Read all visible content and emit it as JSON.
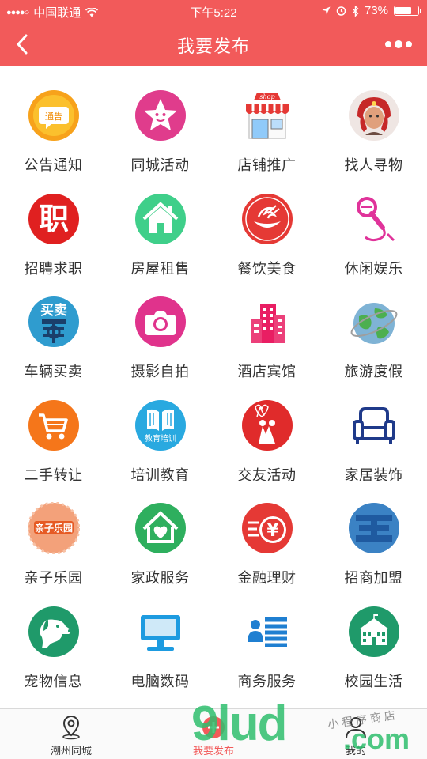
{
  "status_bar": {
    "carrier": "中国联通",
    "time": "下午5:22",
    "battery_text": "73%",
    "battery_level": 0.73
  },
  "nav": {
    "title": "我要发布"
  },
  "grid": {
    "items": [
      {
        "label": "公告通知",
        "icon": "announcement-icon",
        "badge": "通告"
      },
      {
        "label": "同城活动",
        "icon": "star-activity-icon"
      },
      {
        "label": "店铺推广",
        "icon": "shop-icon",
        "badge": "shop"
      },
      {
        "label": "找人寻物",
        "icon": "person-search-icon"
      },
      {
        "label": "招聘求职",
        "icon": "recruit-icon",
        "badge": "职"
      },
      {
        "label": "房屋租售",
        "icon": "house-icon"
      },
      {
        "label": "餐饮美食",
        "icon": "dining-icon"
      },
      {
        "label": "休闲娱乐",
        "icon": "microphone-icon"
      },
      {
        "label": "车辆买卖",
        "icon": "vehicle-trade-icon",
        "badge": "买卖"
      },
      {
        "label": "摄影自拍",
        "icon": "camera-icon"
      },
      {
        "label": "酒店宾馆",
        "icon": "hotel-icon"
      },
      {
        "label": "旅游度假",
        "icon": "globe-icon"
      },
      {
        "label": "二手转让",
        "icon": "cart-icon"
      },
      {
        "label": "培训教育",
        "icon": "education-icon",
        "badge": "教育培训"
      },
      {
        "label": "交友活动",
        "icon": "dating-icon"
      },
      {
        "label": "家居装饰",
        "icon": "sofa-icon"
      },
      {
        "label": "亲子乐园",
        "icon": "family-icon",
        "badge": "亲子乐园"
      },
      {
        "label": "家政服务",
        "icon": "housekeeping-icon"
      },
      {
        "label": "金融理财",
        "icon": "finance-icon",
        "badge": "¥"
      },
      {
        "label": "招商加盟",
        "icon": "franchise-icon"
      },
      {
        "label": "宠物信息",
        "icon": "pet-icon"
      },
      {
        "label": "电脑数码",
        "icon": "computer-icon"
      },
      {
        "label": "商务服务",
        "icon": "business-icon"
      },
      {
        "label": "校园生活",
        "icon": "school-icon"
      }
    ]
  },
  "tabbar": {
    "tabs": [
      {
        "label": "潮州同城",
        "icon": "location-pin-icon"
      },
      {
        "label": "我要发布",
        "icon": "publish-icon",
        "active": true
      },
      {
        "label": "我的",
        "icon": "user-icon"
      }
    ]
  },
  "watermark": {
    "brand": "9lud",
    "domain": ".com",
    "shop_text": "小程序商店"
  },
  "colors": {
    "header": "#f25a5a",
    "active_tab": "#f25a5a"
  }
}
